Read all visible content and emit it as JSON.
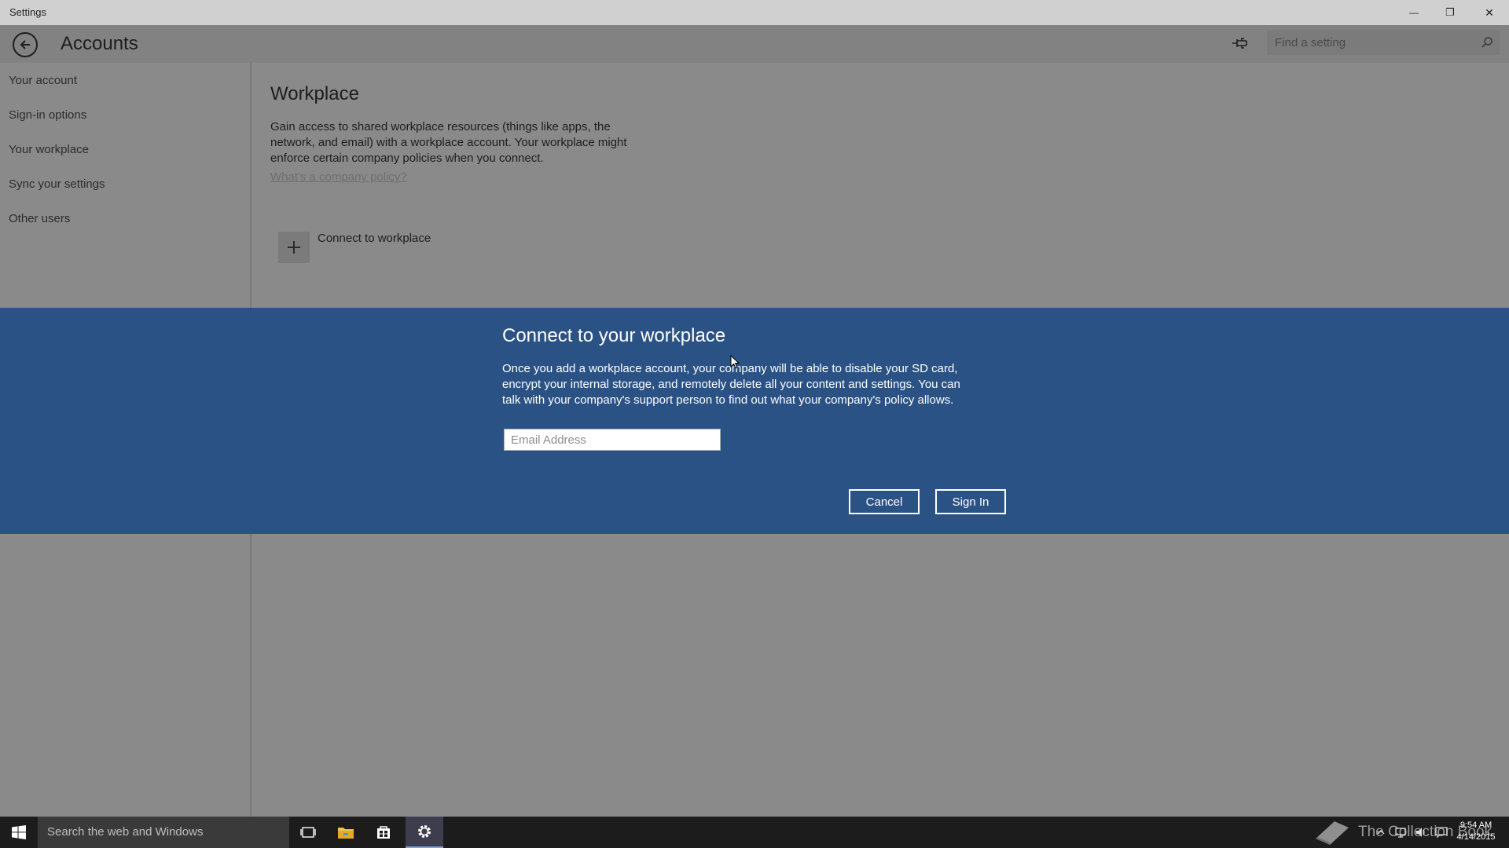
{
  "window": {
    "title": "Settings",
    "minimize_glyph": "—",
    "restore_glyph": "❐",
    "close_glyph": "✕"
  },
  "header": {
    "title": "Accounts",
    "search_placeholder": "Find a setting"
  },
  "sidebar": {
    "items": [
      {
        "label": "Your account"
      },
      {
        "label": "Sign-in options"
      },
      {
        "label": "Your workplace"
      },
      {
        "label": "Sync your settings"
      },
      {
        "label": "Other users"
      }
    ]
  },
  "main": {
    "section_title": "Workplace",
    "description": "Gain access to shared workplace resources (things like apps, the network, and email) with a workplace account. Your workplace might enforce certain company policies when you connect.",
    "policy_link": "What's a company policy?",
    "connect_label": "Connect to workplace"
  },
  "dialog": {
    "title": "Connect to your workplace",
    "description": "Once you add a workplace account, your company will be able to disable your SD card, encrypt your internal storage, and remotely delete all your content and settings.  You can talk with your company's support person to find out what your company's policy allows.",
    "email_placeholder": "Email Address",
    "cancel_label": "Cancel",
    "signin_label": "Sign In",
    "background_color": "#2b5285"
  },
  "taskbar": {
    "search_text": "Search the web and Windows",
    "watermark": "The Collection Book",
    "time": "9:54 AM",
    "date": "4/14/2015",
    "icons": [
      "start-icon",
      "task-view-icon",
      "file-explorer-icon",
      "store-icon",
      "settings-icon"
    ]
  }
}
